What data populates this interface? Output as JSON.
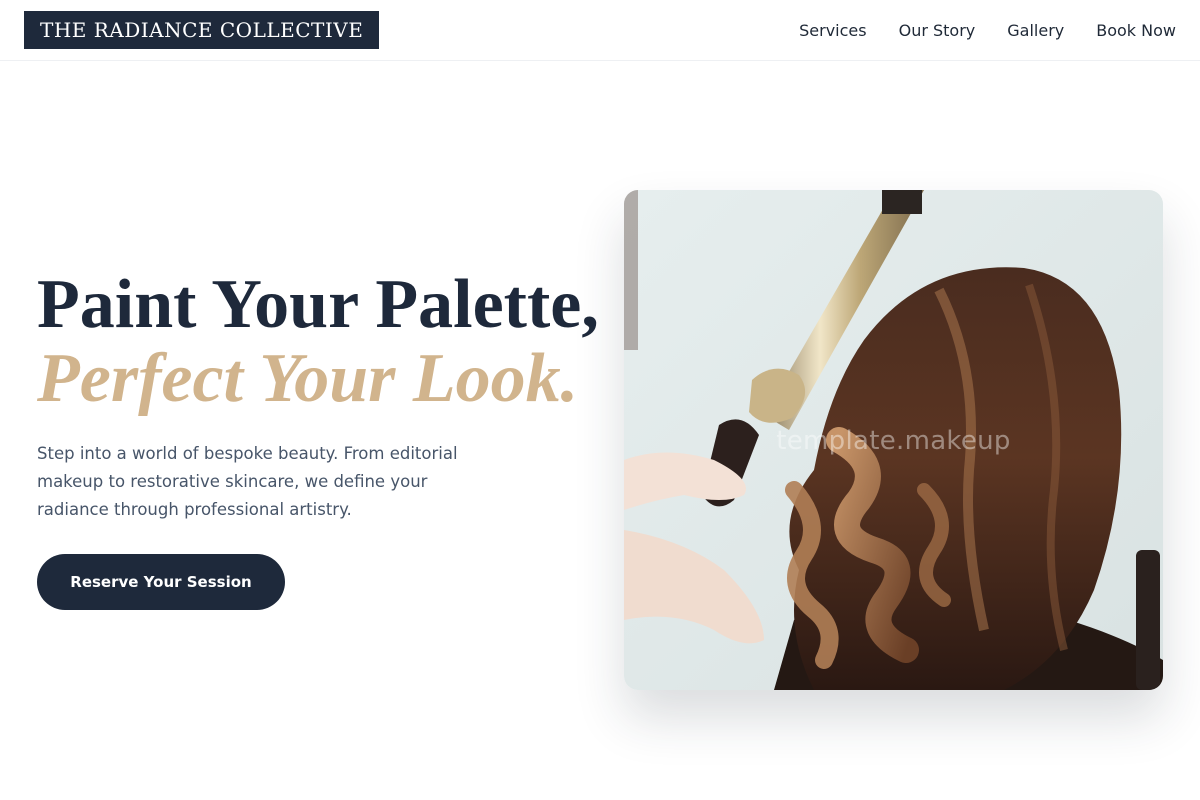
{
  "brand": {
    "name": "THE RADIANCE COLLECTIVE"
  },
  "nav": {
    "items": [
      {
        "label": "Services"
      },
      {
        "label": "Our Story"
      },
      {
        "label": "Gallery"
      },
      {
        "label": "Book Now"
      }
    ]
  },
  "hero": {
    "headline_line1": "Paint Your Palette,",
    "headline_line2": "Perfect Your Look.",
    "intro": "Step into a world of bespoke beauty. From editorial makeup to restorative skincare, we define your radiance through professional artistry.",
    "cta_label": "Reserve Your Session"
  },
  "image": {
    "watermark": "template.makeup",
    "alt": "Stylist curling a client's long brown hair with a curling iron"
  },
  "colors": {
    "navy": "#1e293b",
    "gold": "#d1b48d",
    "body_text": "#475569"
  }
}
